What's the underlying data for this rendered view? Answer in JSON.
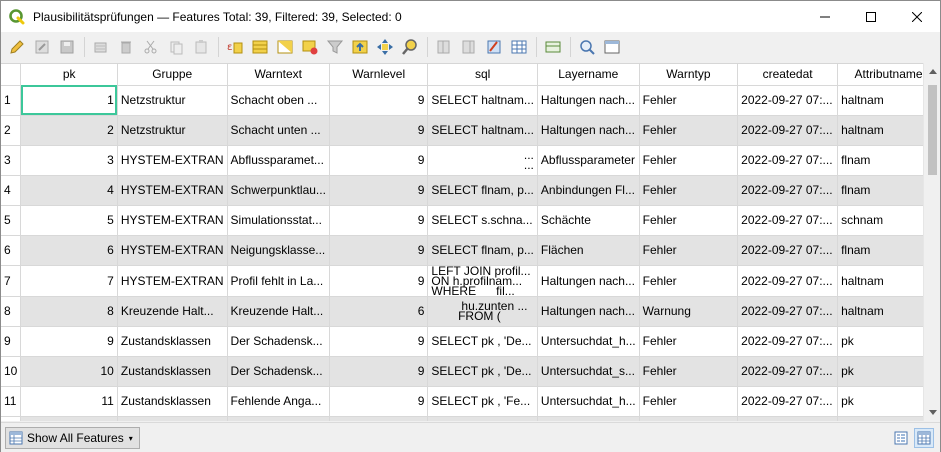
{
  "window": {
    "title": "Plausibilitätsprüfungen — Features Total: 39, Filtered: 39, Selected: 0",
    "controls": [
      "minimize-icon",
      "maximize-icon",
      "close-icon"
    ]
  },
  "toolbar": {
    "buttons": [
      "pencil-edit-icon",
      "multi-edit-icon",
      "save-icon",
      "add-feature-icon",
      "delete-icon",
      "cut-icon",
      "copy-icon",
      "paste-icon",
      "expression-select-icon",
      "select-all-icon",
      "invert-selection-icon",
      "deselect-icon",
      "filter-icon",
      "move-selection-top-icon",
      "pan-to-selection-icon",
      "zoom-to-selection-icon",
      "new-field-icon",
      "delete-field-icon",
      "field-calculator-icon",
      "conditional-formatting-icon",
      "dock-icon",
      "actions-icon",
      "dock-table-icon"
    ]
  },
  "table": {
    "columns": [
      "pk",
      "Gruppe",
      "Warntext",
      "Warnlevel",
      "sql",
      "Layername",
      "Warntyp",
      "createdat",
      "Attributname"
    ],
    "rows": [
      {
        "row": "1",
        "pk": "1",
        "gruppe": "Netzstruktur",
        "warntext": "Schacht oben ...",
        "warnlevel": "9",
        "sql": "SELECT haltnam...",
        "layername": "Haltungen nach...",
        "warntyp": "Fehler",
        "createdat": "2022-09-27 07:...",
        "attributname": "haltnam"
      },
      {
        "row": "2",
        "pk": "2",
        "gruppe": "Netzstruktur",
        "warntext": "Schacht unten ...",
        "warnlevel": "9",
        "sql": "SELECT haltnam...",
        "layername": "Haltungen nach...",
        "warntyp": "Fehler",
        "createdat": "2022-09-27 07:...",
        "attributname": "haltnam"
      },
      {
        "row": "3",
        "pk": "3",
        "gruppe": "HYSTEM-EXTRAN",
        "warntext": "Abflussparamet...",
        "warnlevel": "9",
        "sql": "...\n...",
        "layername": "Abflussparameter",
        "warntyp": "Fehler",
        "createdat": "2022-09-27 07:...",
        "attributname": "flnam"
      },
      {
        "row": "4",
        "pk": "4",
        "gruppe": "HYSTEM-EXTRAN",
        "warntext": "Schwerpunktlau...",
        "warnlevel": "9",
        "sql": "SELECT flnam, p...",
        "layername": "Anbindungen Fl...",
        "warntyp": "Fehler",
        "createdat": "2022-09-27 07:...",
        "attributname": "flnam"
      },
      {
        "row": "5",
        "pk": "5",
        "gruppe": "HYSTEM-EXTRAN",
        "warntext": "Simulationsstat...",
        "warnlevel": "9",
        "sql": "SELECT s.schna...",
        "layername": "Schächte",
        "warntyp": "Fehler",
        "createdat": "2022-09-27 07:...",
        "attributname": "schnam"
      },
      {
        "row": "6",
        "pk": "6",
        "gruppe": "HYSTEM-EXTRAN",
        "warntext": "Neigungsklasse...",
        "warnlevel": "9",
        "sql": "SELECT flnam, p...",
        "layername": "Flächen",
        "warntyp": "Fehler",
        "createdat": "2022-09-27 07:...",
        "attributname": "flnam"
      },
      {
        "row": "7",
        "pk": "7",
        "gruppe": "HYSTEM-EXTRAN",
        "warntext": "Profil fehlt in La...",
        "warnlevel": "9",
        "sql": "LEFT JOIN profil...\nON h.profilnam...\nWHERE      fil...",
        "layername": "Haltungen nach...",
        "warntyp": "Fehler",
        "createdat": "2022-09-27 07:...",
        "attributname": "haltnam"
      },
      {
        "row": "8",
        "pk": "8",
        "gruppe": "Kreuzende Halt...",
        "warntext": "Kreuzende Halt...",
        "warnlevel": "6",
        "sql": "         hu.zunten ...\n        FROM (",
        "layername": "Haltungen nach...",
        "warntyp": "Warnung",
        "createdat": "2022-09-27 07:...",
        "attributname": "haltnam"
      },
      {
        "row": "9",
        "pk": "9",
        "gruppe": "Zustandsklassen",
        "warntext": "Der Schadensk...",
        "warnlevel": "9",
        "sql": "SELECT pk , 'De...",
        "layername": "Untersuchdat_h...",
        "warntyp": "Fehler",
        "createdat": "2022-09-27 07:...",
        "attributname": "pk"
      },
      {
        "row": "10",
        "pk": "10",
        "gruppe": "Zustandsklassen",
        "warntext": "Der Schadensk...",
        "warnlevel": "9",
        "sql": "SELECT pk , 'De...",
        "layername": "Untersuchdat_s...",
        "warntyp": "Fehler",
        "createdat": "2022-09-27 07:...",
        "attributname": "pk"
      },
      {
        "row": "11",
        "pk": "11",
        "gruppe": "Zustandsklassen",
        "warntext": "Fehlende Anga...",
        "warnlevel": "9",
        "sql": "SELECT pk , 'Fe...",
        "layername": "Untersuchdat_h...",
        "warntyp": "Fehler",
        "createdat": "2022-09-27 07:...",
        "attributname": "pk"
      }
    ]
  },
  "bottombar": {
    "filter_label": "Show All Features",
    "view_buttons": [
      "form-view-icon",
      "table-view-icon"
    ]
  },
  "colors": {
    "selection_outline": "#3cc79a",
    "alt_row": "#e3e3e3",
    "qgis_green": "#589632",
    "qgis_yellow": "#eec90d"
  }
}
